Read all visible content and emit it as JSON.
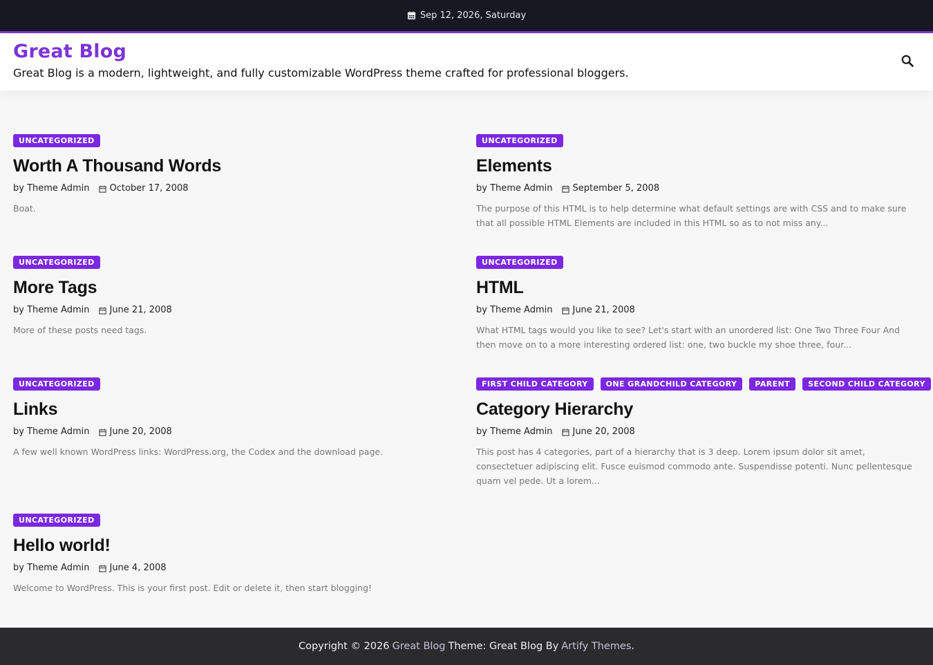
{
  "topbar": {
    "date": "Sep 12, 2026, Saturday"
  },
  "header": {
    "title": "Great Blog",
    "description": "Great Blog is a modern, lightweight, and fully customizable WordPress theme crafted for professional bloggers."
  },
  "posts": [
    {
      "categories": [
        "UNCATEGORIZED"
      ],
      "title": "Worth A Thousand Words",
      "author": "by Theme Admin",
      "date": "October 17, 2008",
      "excerpt": "Boat."
    },
    {
      "categories": [
        "UNCATEGORIZED"
      ],
      "title": "Elements",
      "author": "by Theme Admin",
      "date": "September 5, 2008",
      "excerpt": "The purpose of this HTML is to help determine what default settings are with CSS and to make sure that all possible HTML Elements are included in this HTML so as to not miss any..."
    },
    {
      "categories": [
        "UNCATEGORIZED"
      ],
      "title": "More Tags",
      "author": "by Theme Admin",
      "date": "June 21, 2008",
      "excerpt": "More of these posts need tags."
    },
    {
      "categories": [
        "UNCATEGORIZED"
      ],
      "title": "HTML",
      "author": "by Theme Admin",
      "date": "June 21, 2008",
      "excerpt": "What HTML tags would you like to see? Let's start with an unordered list: One Two Three Four And then move on to a more interesting ordered list: one, two buckle my shoe three, four..."
    },
    {
      "categories": [
        "UNCATEGORIZED"
      ],
      "title": "Links",
      "author": "by Theme Admin",
      "date": "June 20, 2008",
      "excerpt": "A few well known WordPress links: WordPress.org, the Codex and the download page."
    },
    {
      "categories": [
        "FIRST CHILD CATEGORY",
        "ONE GRANDCHILD CATEGORY",
        "PARENT",
        "SECOND CHILD CATEGORY"
      ],
      "title": "Category Hierarchy",
      "author": "by Theme Admin",
      "date": "June 20, 2008",
      "excerpt": "This post has 4 categories, part of a hierarchy that is 3 deep. Lorem ipsum dolor sit amet, consectetuer adipiscing elit. Fusce euismod commodo ante. Suspendisse potenti. Nunc pellentesque quam vel pede. Ut a lorem..."
    },
    {
      "categories": [
        "UNCATEGORIZED"
      ],
      "title": "Hello world!",
      "author": "by Theme Admin",
      "date": "June 4, 2008",
      "excerpt": "Welcome to WordPress. This is your first post. Edit or delete it, then start blogging!"
    }
  ],
  "footer": {
    "copyright": "Copyright © 2026",
    "site_link": "Great Blog",
    "theme_text": "Theme: Great Blog By",
    "author_link": "Artify Themes",
    "period": "."
  },
  "colors": {
    "accent": "#7c34d9",
    "topbar": "#181822",
    "footer": "#2b2b2d"
  },
  "icons": {
    "date": "calendar-icon",
    "search": "search-icon"
  }
}
